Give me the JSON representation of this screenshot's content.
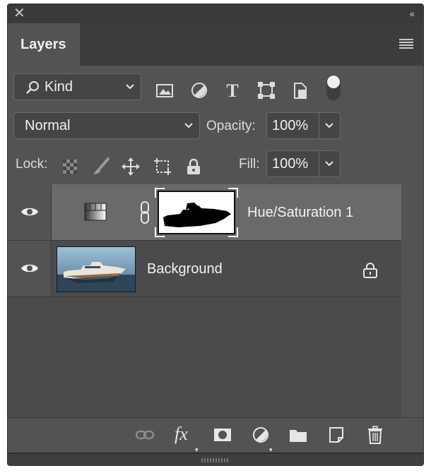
{
  "panel": {
    "tab_label": "Layers"
  },
  "filter": {
    "kind_label": "Kind",
    "icons": [
      "image-filter-icon",
      "adjustment-filter-icon",
      "type-filter-icon",
      "shape-filter-icon",
      "smart-object-filter-icon",
      "filter-toggle-icon"
    ]
  },
  "blend": {
    "mode": "Normal",
    "opacity_label": "Opacity:",
    "opacity_value": "100%"
  },
  "lock": {
    "label": "Lock:",
    "fill_label": "Fill:",
    "fill_value": "100%"
  },
  "layers": [
    {
      "name": "Hue/Saturation 1",
      "type": "adjustment",
      "visible": true,
      "selected": true
    },
    {
      "name": "Background",
      "type": "pixel",
      "visible": true,
      "locked": true
    }
  ],
  "bottom_toolbar": {
    "fx_label": "fx",
    "icons": [
      "link-layers-icon",
      "fx-icon",
      "mask-icon",
      "adjustment-icon",
      "group-icon",
      "new-layer-icon",
      "trash-icon"
    ]
  },
  "colors": {
    "panel_bg": "#535353",
    "selected_row": "#6a6a6a",
    "dark": "#3a3a3a"
  }
}
